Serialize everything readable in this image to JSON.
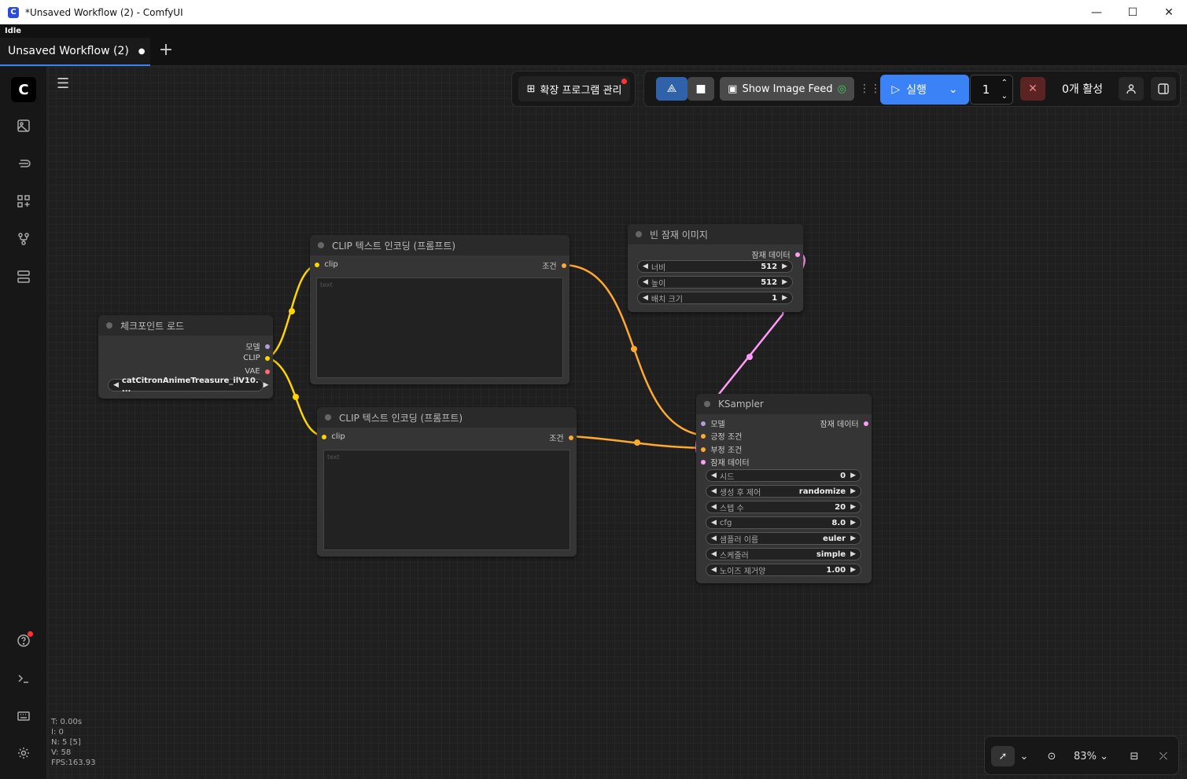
{
  "window": {
    "title": "*Unsaved Workflow (2) - ComfyUI",
    "app_icon": "C",
    "minimize": "—",
    "maximize": "☐",
    "close": "✕"
  },
  "status": "Idle",
  "tabs": [
    {
      "label": "Unsaved Workflow (2)",
      "modified": "●"
    }
  ],
  "tab_add": "+",
  "toolbar": {
    "extensions_label": "확장 프로그램 관리",
    "image_feed_label": "Show Image Feed",
    "run_label": "실행",
    "batch_count": "1",
    "active_label": "0개 활성"
  },
  "nodes": {
    "checkpoint": {
      "title": "체크포인트 로드",
      "outputs": [
        "모델",
        "CLIP",
        "VAE"
      ],
      "ckpt_name": "catCitronAnimeTreasure_ilV10. ..."
    },
    "clip_top": {
      "title": "CLIP 텍스트 인코딩 (프롬프트)",
      "input": "clip",
      "output": "조건",
      "placeholder": "text"
    },
    "clip_bottom": {
      "title": "CLIP 텍스트 인코딩 (프롬프트)",
      "input": "clip",
      "output": "조건",
      "placeholder": "text"
    },
    "empty_latent": {
      "title": "빈 잠재 이미지",
      "output": "잠재 데이터",
      "widgets": [
        {
          "label": "너비",
          "value": "512"
        },
        {
          "label": "높이",
          "value": "512"
        },
        {
          "label": "배치 크기",
          "value": "1"
        }
      ]
    },
    "ksampler": {
      "title": "KSampler",
      "inputs": [
        "모델",
        "긍정 조건",
        "부정 조건",
        "잠재 데이터"
      ],
      "output": "잠재 데이터",
      "widgets": [
        {
          "label": "시드",
          "value": "0"
        },
        {
          "label": "생성 후 제어",
          "value": "randomize"
        },
        {
          "label": "스텝 수",
          "value": "20"
        },
        {
          "label": "cfg",
          "value": "8.0"
        },
        {
          "label": "샘플러 이름",
          "value": "euler"
        },
        {
          "label": "스케줄러",
          "value": "simple"
        },
        {
          "label": "노이즈 제거양",
          "value": "1.00"
        }
      ]
    }
  },
  "stats": [
    "T: 0.00s",
    "I: 0",
    "N: 5 [5]",
    "V: 58",
    "FPS:163.93"
  ],
  "zoom": "83%",
  "colors": {
    "clip": "#ffd500",
    "conditioning": "#ffa931",
    "latent": "#ff9cf9",
    "model": "#b39ddb",
    "vae": "#ff6e6e",
    "accent": "#3b82f6"
  }
}
